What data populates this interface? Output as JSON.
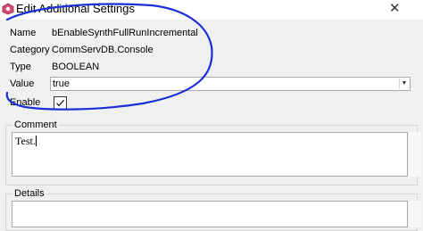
{
  "window": {
    "title": "Edit Additional Settings",
    "icon": "app-icon",
    "close_glyph": "✕"
  },
  "fields": {
    "name_label": "Name",
    "name_value": "bEnableSynthFullRunIncremental",
    "category_label": "Category",
    "category_value": "CommServDB.Console",
    "type_label": "Type",
    "type_value": "BOOLEAN",
    "value_label": "Value",
    "value_selected": "true",
    "enable_label": "Enable",
    "enable_checked": true
  },
  "comment": {
    "label": "Comment",
    "text": "Test."
  },
  "details": {
    "label": "Details"
  },
  "colors": {
    "annotation": "#1a2fd6",
    "window_bg": "#f0f0f0",
    "field_border": "#a9a9a9"
  }
}
